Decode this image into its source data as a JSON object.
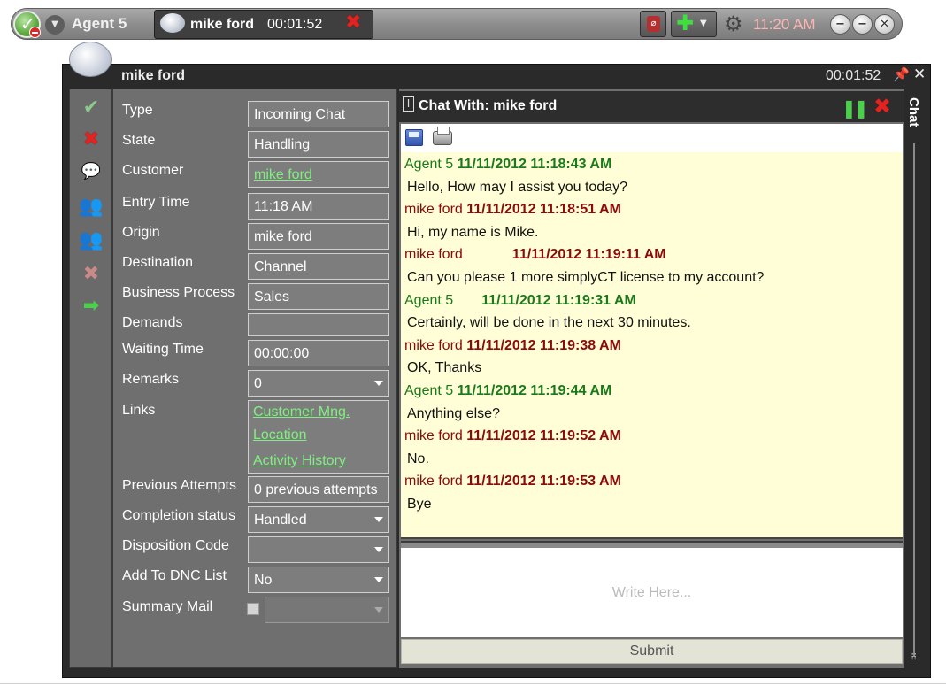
{
  "topbar": {
    "agent_name": "Agent 5",
    "tab_name": "mike ford",
    "tab_timer": "00:01:52",
    "clock": "11:20 AM"
  },
  "window": {
    "title": "mike ford",
    "timer": "00:01:52",
    "side_tab": "Chat"
  },
  "form": {
    "fields": [
      {
        "label": "Type",
        "value": "Incoming Chat"
      },
      {
        "label": "State",
        "value": "Handling"
      },
      {
        "label": "Customer",
        "value": "mike ford"
      },
      {
        "label": "Entry Time",
        "value": "11:18 AM"
      },
      {
        "label": "Origin",
        "value": "mike ford"
      },
      {
        "label": "Destination",
        "value": "Channel"
      },
      {
        "label": "Business Process",
        "value": "Sales"
      },
      {
        "label": "Demands",
        "value": ""
      },
      {
        "label": "Waiting Time",
        "value": "00:00:00"
      },
      {
        "label": "Remarks",
        "value": "0"
      },
      {
        "label": "Links",
        "value": ""
      },
      {
        "label": "Previous Attempts",
        "value": "0 previous attempts"
      },
      {
        "label": "Completion status",
        "value": "Handled"
      },
      {
        "label": "Disposition Code",
        "value": ""
      },
      {
        "label": "Add To DNC List",
        "value": "No"
      },
      {
        "label": "Summary Mail",
        "value": ""
      }
    ],
    "links": [
      "Customer Mng.",
      "Location",
      "Activity History"
    ]
  },
  "chat": {
    "title": "Chat With: mike ford",
    "messages": [
      {
        "sender": "Agent 5",
        "timestamp": "11/11/2012 11:18:43 AM",
        "text": "Hello, How may I assist you today?"
      },
      {
        "sender": "mike ford",
        "timestamp": "11/11/2012 11:18:51 AM",
        "text": "Hi, my name is Mike."
      },
      {
        "sender": "mike ford",
        "timestamp": "11/11/2012 11:19:11 AM",
        "text": "Can you please 1 more simplyCT license to my account?"
      },
      {
        "sender": "Agent 5",
        "timestamp": "11/11/2012 11:19:31 AM",
        "text": "Certainly, will be done in the next 30 minutes."
      },
      {
        "sender": "mike ford",
        "timestamp": "11/11/2012 11:19:38 AM",
        "text": "OK, Thanks"
      },
      {
        "sender": "Agent 5",
        "timestamp": "11/11/2012 11:19:44 AM",
        "text": "Anything else?"
      },
      {
        "sender": "mike ford",
        "timestamp": "11/11/2012 11:19:52 AM",
        "text": "No."
      },
      {
        "sender": "mike ford",
        "timestamp": "11/11/2012 11:19:53 AM",
        "text": "Bye"
      }
    ],
    "input_placeholder": "Write Here...",
    "submit_label": "Submit"
  },
  "colors": {
    "agent": "#1a7a1a",
    "customer": "#8b0a0a",
    "link": "#7ff07f",
    "transcript_bg": "#fffed6"
  }
}
